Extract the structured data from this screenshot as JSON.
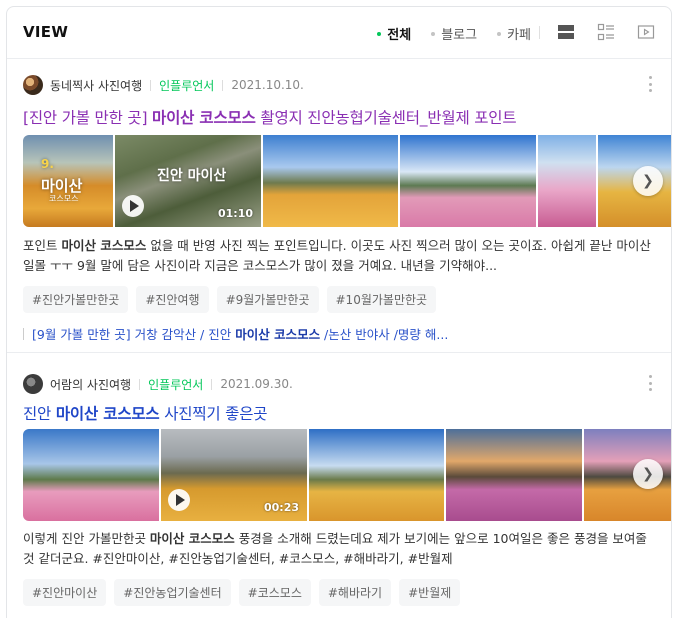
{
  "header": {
    "title": "VIEW",
    "filters": [
      "전체",
      "블로그",
      "카페"
    ],
    "active_filter": "전체"
  },
  "posts": [
    {
      "author": "동네찍사 사진여행",
      "badge": "인플루언서",
      "date": "2021.10.10.",
      "title_pre": "[진안 가볼 만한 곳] ",
      "title_bold": "마이산 코스모스",
      "title_post": " 촬영지 진안농협기술센터_반월제 포인트",
      "thumb_overlay_1": "9.",
      "thumb_overlay_2": "마이산",
      "thumb_overlay_3": "코스모스",
      "video_overlay": "진안 마이산",
      "video_duration": "01:10",
      "desc_pre": "포인트 ",
      "desc_bold": "마이산 코스모스",
      "desc_post": " 없을 때 반영 사진 찍는 포인트입니다. 이곳도 사진 찍으러 많이 오는 곳이죠. 아쉽게 끝난 마이산 일몰 ㅜㅜ 9월 말에 담은 사진이라 지금은 코스모스가 많이 졌을 거예요. 내년을 기약해야...",
      "tags": [
        "#진안가볼만한곳",
        "#진안여행",
        "#9월가볼만한곳",
        "#10월가볼만한곳"
      ],
      "related_pre": "[9월 가볼 만한 곳] 거창 감악산 / 진안 ",
      "related_bold": "마이산 코스모스",
      "related_post": " /논산 반야사 /명량 해..."
    },
    {
      "author": "어람의 사진여행",
      "badge": "인플루언서",
      "date": "2021.09.30.",
      "title_pre": "진안 ",
      "title_bold": "마이산 코스모스",
      "title_post": " 사진찍기 좋은곳",
      "video_duration": "00:23",
      "desc_pre": "이렇게 진안 가볼만한곳 ",
      "desc_bold": "마이산 코스모스",
      "desc_post": " 풍경을 소개해 드렸는데요 제가 보기에는 앞으로 10여일은 좋은 풍경을 보여줄것 같더군요. #진안마이산, #진안농업기술센터, #코스모스, #해바라기, #반월제",
      "tags": [
        "#진안마이산",
        "#진안농업기술센터",
        "#코스모스",
        "#해바라기",
        "#반월제"
      ]
    }
  ],
  "colors": {
    "accent_green": "#03c75a",
    "title_visited": "#8a2fb3",
    "title_link": "#1f46c8"
  },
  "icons": [
    "list-view-icon",
    "grid-view-icon",
    "video-view-icon",
    "play-icon",
    "next-arrow-icon",
    "more-options-icon"
  ]
}
